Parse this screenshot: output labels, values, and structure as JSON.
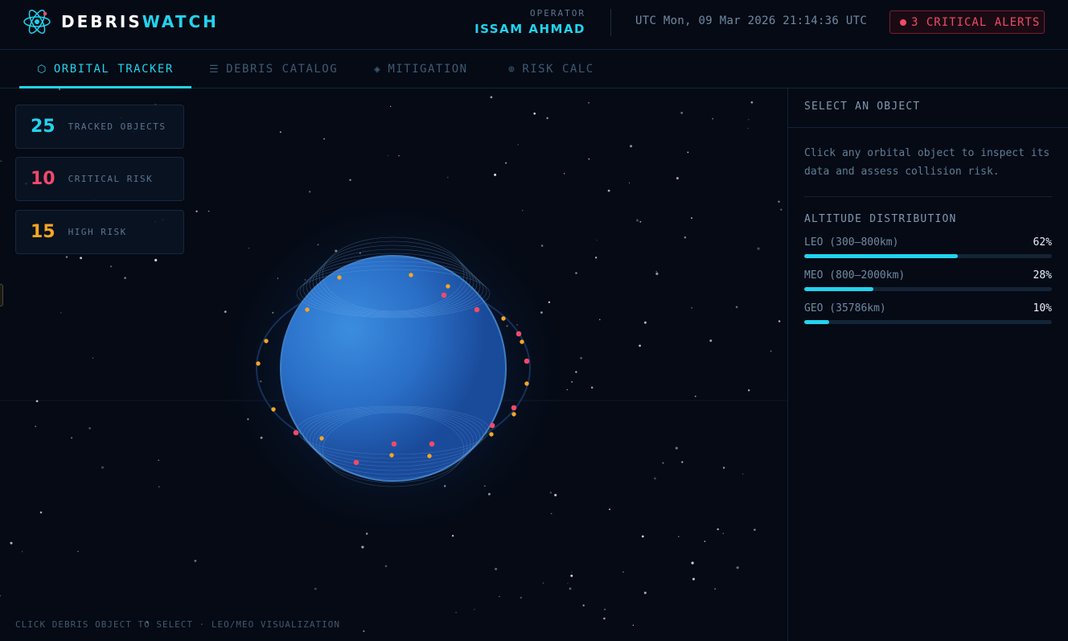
{
  "app": {
    "brand_a": "DEBRIS",
    "brand_b": "WATCH"
  },
  "header": {
    "operator_label": "OPERATOR",
    "operator_name": "ISSAM AHMAD",
    "clock": "UTC Mon, 09 Mar 2026 21:14:36 UTC",
    "alerts": "3 CRITICAL ALERTS"
  },
  "tabs": [
    {
      "icon": "⬡",
      "label": "ORBITAL TRACKER",
      "active": true
    },
    {
      "icon": "☰",
      "label": "DEBRIS CATALOG",
      "active": false
    },
    {
      "icon": "◈",
      "label": "MITIGATION",
      "active": false
    },
    {
      "icon": "⊕",
      "label": "RISK CALC",
      "active": false
    }
  ],
  "stats": [
    {
      "value": "25",
      "label": "TRACKED OBJECTS",
      "color": "#22d3ee"
    },
    {
      "value": "10",
      "label": "CRITICAL RISK",
      "color": "#f04a6a"
    },
    {
      "value": "15",
      "label": "HIGH RISK",
      "color": "#f5a623"
    }
  ],
  "hint": "CLICK DEBRIS OBJECT TO SELECT · LEO/MEO VISUALIZATION",
  "panel": {
    "title": "SELECT AN OBJECT",
    "description": "Click any orbital object to inspect its data and assess collision risk.",
    "dist_title": "ALTITUDE DISTRIBUTION",
    "distribution": [
      {
        "label": "LEO (300–800km)",
        "value": "62%",
        "fraction": 0.62
      },
      {
        "label": "MEO (800–2000km)",
        "value": "28%",
        "fraction": 0.28
      },
      {
        "label": "GEO (35786km)",
        "value": "10%",
        "fraction": 0.1
      }
    ]
  },
  "colors": {
    "accent": "#22d3ee",
    "critical": "#f04a6a",
    "high": "#f5a623"
  }
}
